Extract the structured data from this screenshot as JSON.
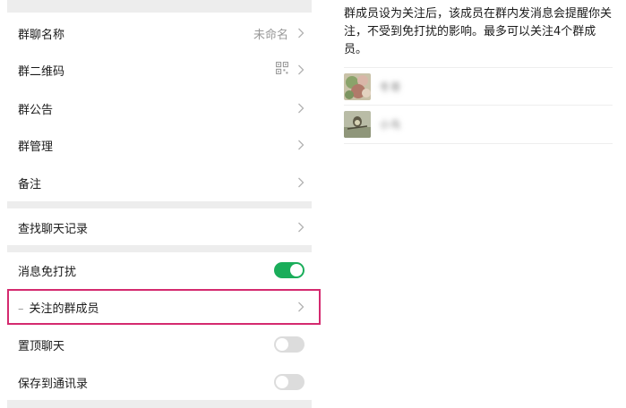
{
  "settings": {
    "group_name": {
      "label": "群聊名称",
      "value": "未命名"
    },
    "qr_code": {
      "label": "群二维码"
    },
    "announcement": {
      "label": "群公告"
    },
    "manage": {
      "label": "群管理"
    },
    "remark": {
      "label": "备注"
    },
    "search_history": {
      "label": "查找聊天记录"
    },
    "mute": {
      "label": "消息免打扰",
      "on": true
    },
    "followed_members": {
      "label": "关注的群成员"
    },
    "pin_chat": {
      "label": "置顶聊天",
      "on": false
    },
    "save_contacts": {
      "label": "保存到通讯录",
      "on": false
    }
  },
  "detail": {
    "description": "群成员设为关注后，该成员在群内发消息会提醒你关注，不受到免打扰的影响。最多可以关注4个群成员。",
    "members": [
      {
        "name": "冬哥"
      },
      {
        "name": "小鸟"
      }
    ]
  },
  "colors": {
    "toggle_on": "#1aad5a",
    "toggle_off": "#dcdcdc",
    "highlight": "#d42a6f"
  }
}
